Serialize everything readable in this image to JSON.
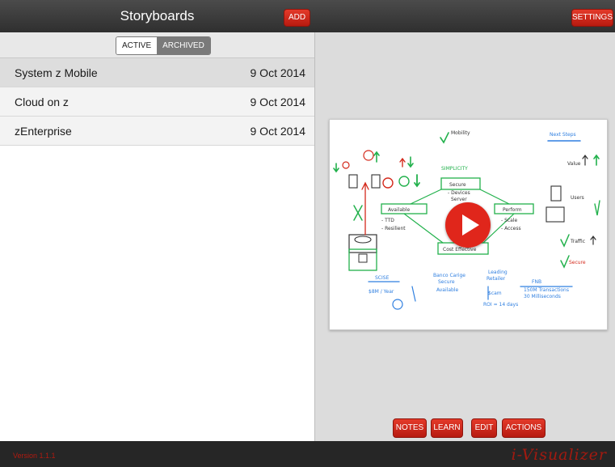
{
  "header": {
    "title": "Storyboards",
    "add_label": "ADD",
    "settings_label": "SETTINGS"
  },
  "segment": {
    "active_label": "ACTIVE",
    "archived_label": "ARCHIVED",
    "selected": "ACTIVE"
  },
  "storyboards": [
    {
      "name": "System z Mobile",
      "date": "9 Oct 2014"
    },
    {
      "name": "Cloud on z",
      "date": "9 Oct 2014"
    },
    {
      "name": "zEnterprise",
      "date": "9 Oct 2014"
    }
  ],
  "preview": {
    "labels": {
      "mobility": "Mobility",
      "next_steps": "Next Steps",
      "simplicity": "SIMPLICITY",
      "secure_box": "Secure",
      "devices": "- Devices",
      "server": "Server",
      "available": "Available",
      "ttd": "- TTD",
      "resilient": "- Resilient",
      "perform": "Perform",
      "scale": "- Scale",
      "access": "- Access",
      "cost_effective": "Cost Effective",
      "value": "Value",
      "users": "Users",
      "traffic": "Traffic",
      "secure_q": "Secure",
      "scise": "SCISE",
      "per_year": "$8M / Year",
      "banco": "Banco Carige",
      "banco_secure": "Secure",
      "banco_available": "Available",
      "leading": "Leading",
      "retailer": "Retailer",
      "dollar_sign": "$cam",
      "roi": "ROI = 14 days",
      "fnb": "FNB",
      "transactions": "150M Transactions",
      "milliseconds": "30 Milliseconds"
    }
  },
  "buttons": {
    "notes": "NOTES",
    "learn": "LEARN",
    "edit": "EDIT",
    "actions": "ACTIONS"
  },
  "footer": {
    "version": "Version 1.1.1",
    "brand": "i-Visualizer"
  },
  "colors": {
    "accent_red": "#d42a1c",
    "toolbar_dark": "#3b3b3b",
    "sketch_green": "#22b14c",
    "sketch_blue": "#2f7fe0"
  }
}
